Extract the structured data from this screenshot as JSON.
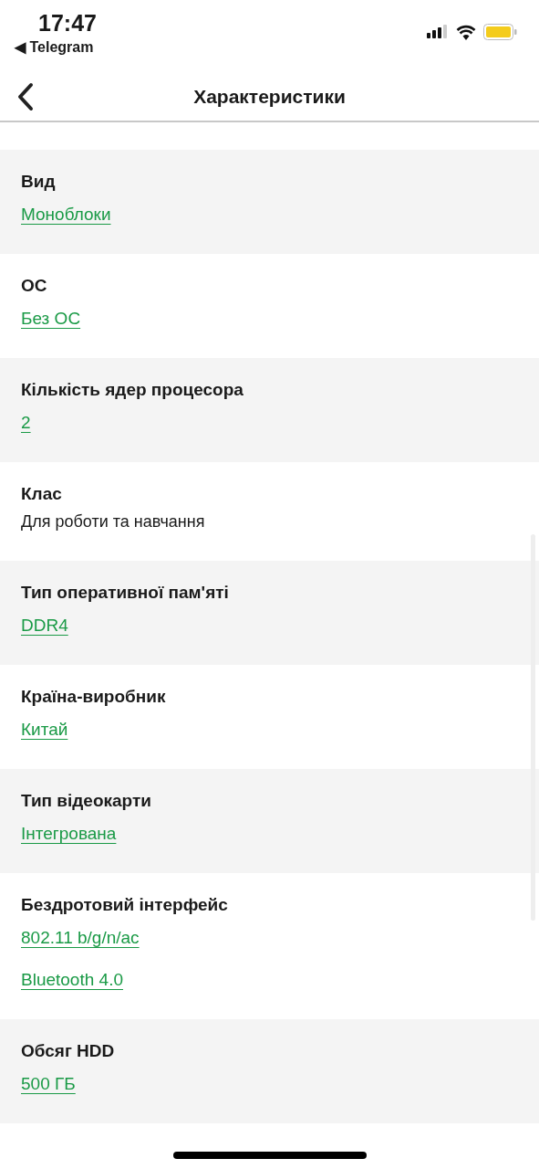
{
  "status_bar": {
    "time": "17:47",
    "back_app": "◀ Telegram"
  },
  "nav_bar": {
    "title": "Характеристики"
  },
  "specs": [
    {
      "label": "Вид",
      "values": [
        {
          "kind": "link",
          "text": "Моноблоки"
        }
      ]
    },
    {
      "label": "ОС",
      "values": [
        {
          "kind": "link",
          "text": "Без ОС"
        }
      ]
    },
    {
      "label": "Кількість ядер процесора",
      "values": [
        {
          "kind": "link",
          "text": "2"
        }
      ]
    },
    {
      "label": "Клас",
      "values": [
        {
          "kind": "text",
          "text": "Для роботи та навчання"
        }
      ]
    },
    {
      "label": "Тип оперативної пам'яті",
      "values": [
        {
          "kind": "link",
          "text": "DDR4"
        }
      ]
    },
    {
      "label": "Країна-виробник",
      "values": [
        {
          "kind": "link",
          "text": "Китай"
        }
      ]
    },
    {
      "label": "Тип відеокарти",
      "values": [
        {
          "kind": "link",
          "text": "Інтегрована"
        }
      ]
    },
    {
      "label": "Бездротовий інтерфейс",
      "values": [
        {
          "kind": "link",
          "text": "802.11 b/g/n/ac"
        },
        {
          "kind": "link",
          "text": "Bluetooth 4.0"
        }
      ]
    },
    {
      "label": "Обсяг HDD",
      "values": [
        {
          "kind": "link",
          "text": "500 ГБ"
        }
      ]
    }
  ]
}
